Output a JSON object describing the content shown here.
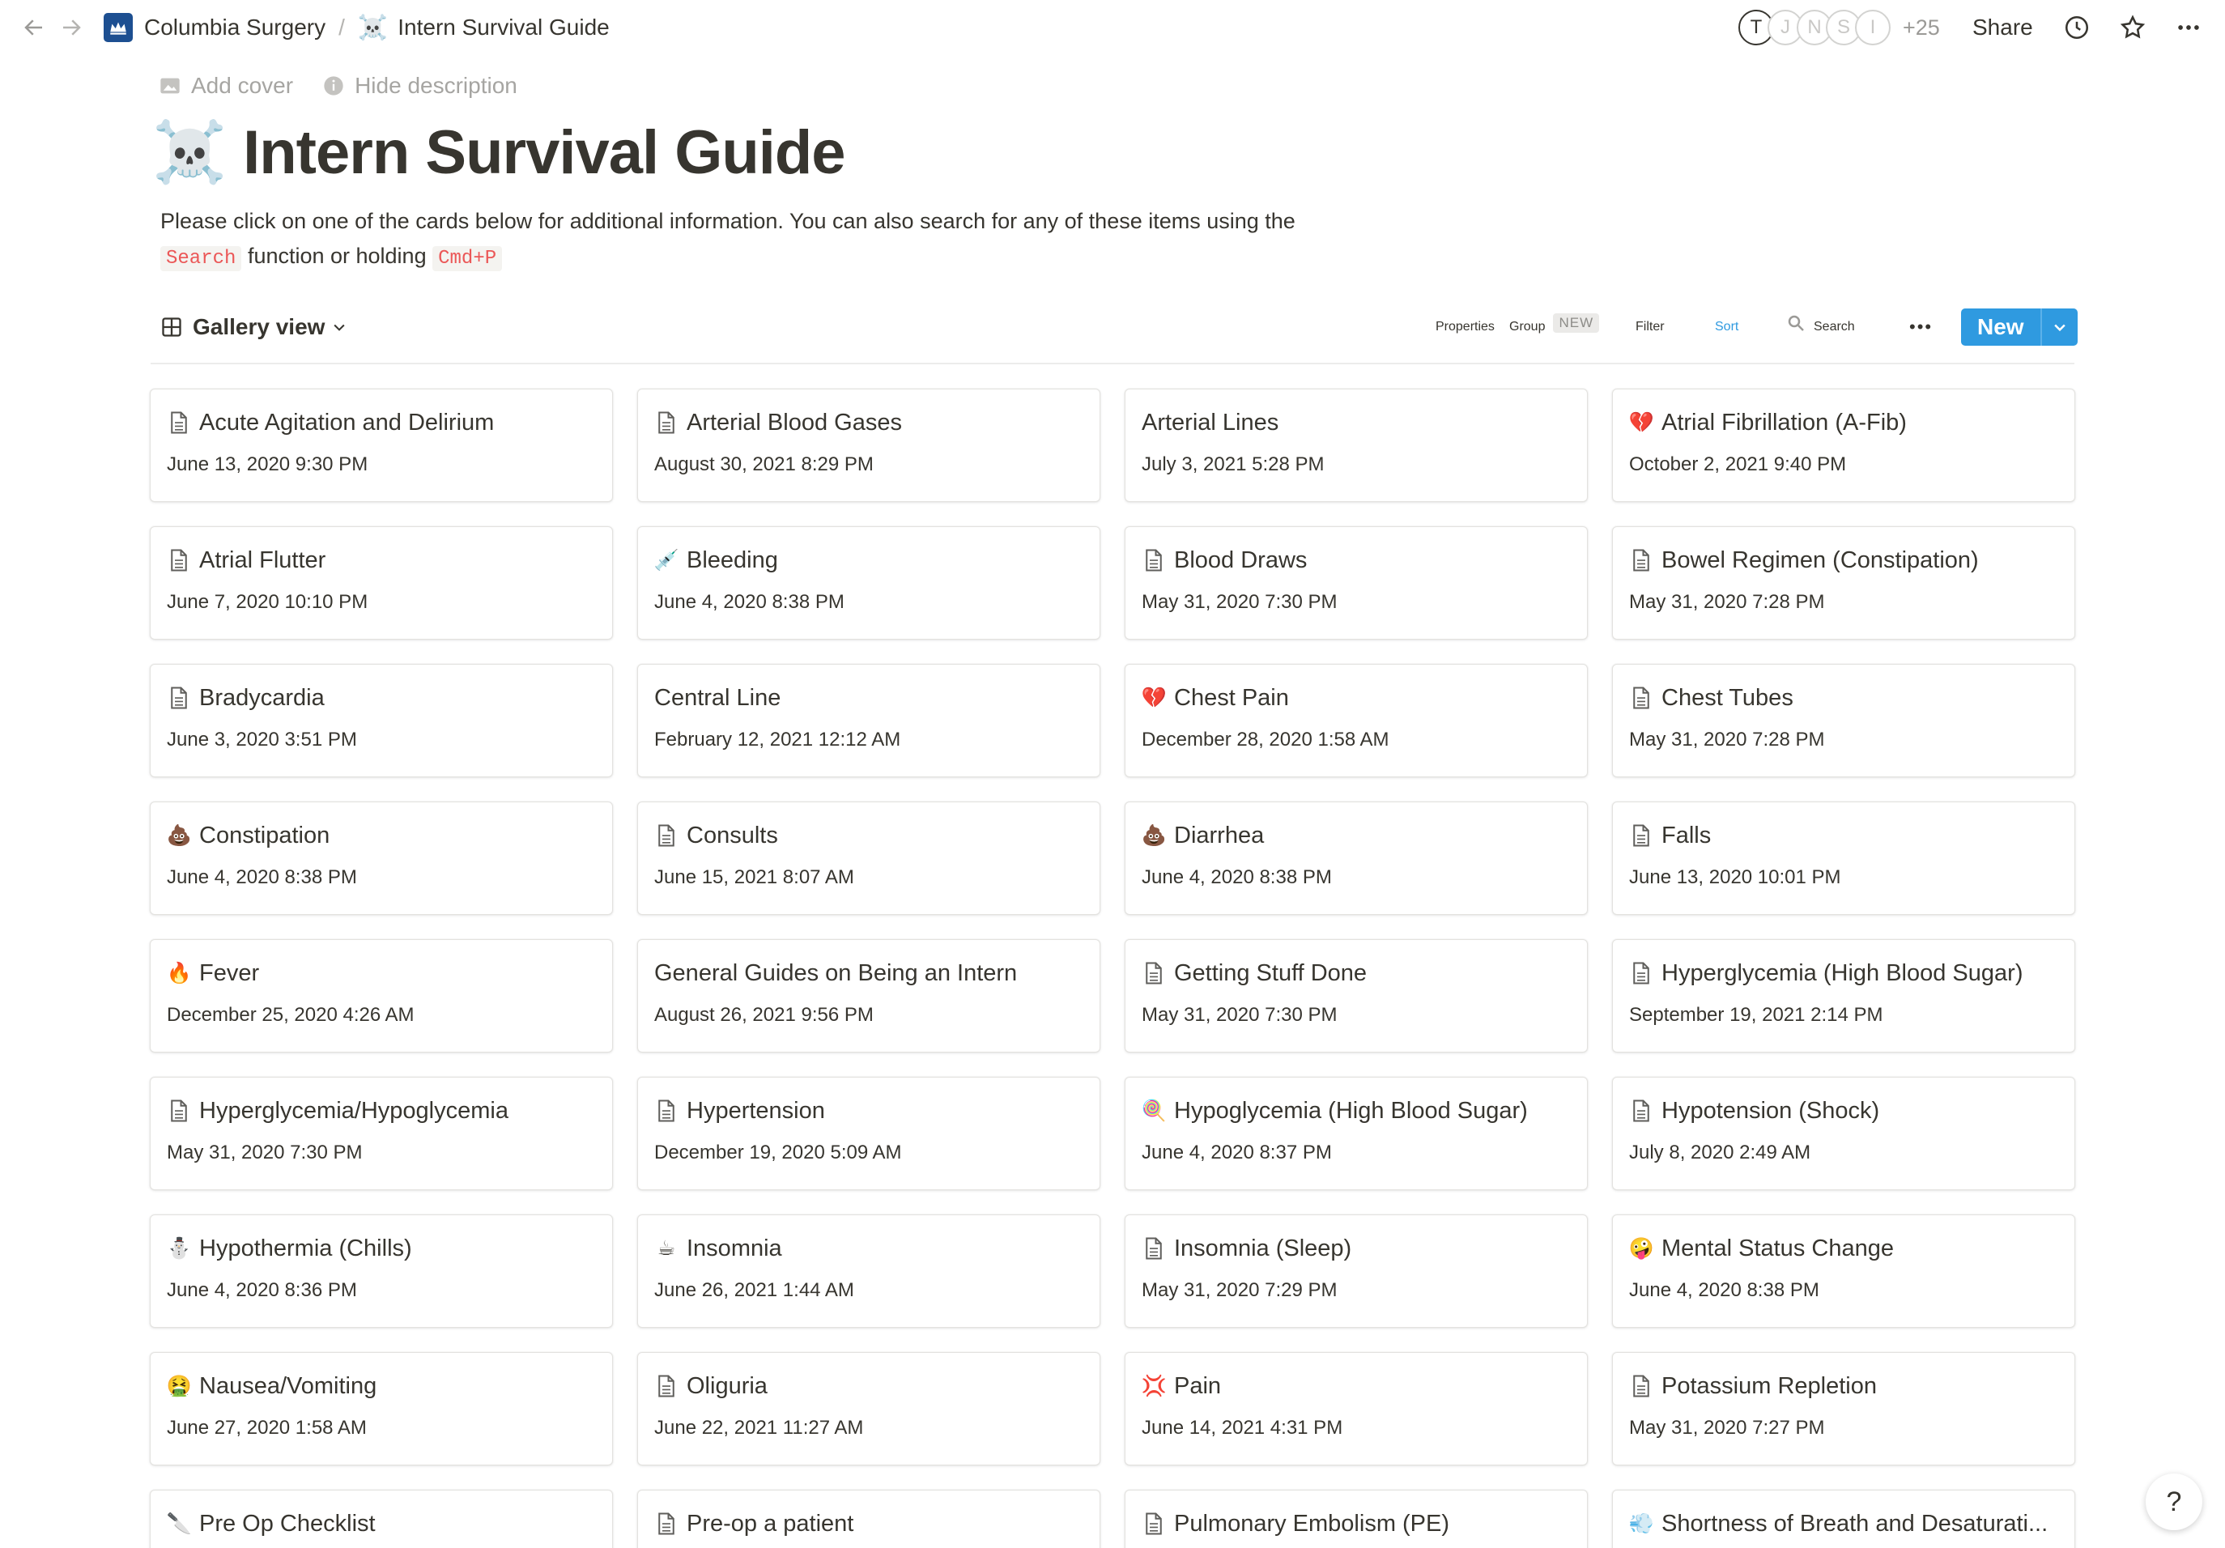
{
  "breadcrumb": {
    "workspace": "Columbia Surgery",
    "separator": "/",
    "page_emoji": "☠️",
    "page": "Intern Survival Guide"
  },
  "topbar": {
    "avatars": [
      "T",
      "J",
      "N",
      "S",
      "I"
    ],
    "more_users": "+25",
    "share": "Share"
  },
  "page_meta": {
    "add_cover": "Add cover",
    "hide_description": "Hide description"
  },
  "title": {
    "emoji": "☠️",
    "text": "Intern Survival Guide"
  },
  "description": {
    "line1": "Please click on one of the cards below for additional information. You can also search for any of these items using the",
    "code1": "Search",
    "middle": "function or holding",
    "code2": "Cmd+P"
  },
  "view": {
    "label": "Gallery view",
    "properties": "Properties",
    "group": "Group",
    "group_badge": "NEW",
    "filter": "Filter",
    "sort": "Sort",
    "search": "Search",
    "more": "•••",
    "new": "New"
  },
  "cards": [
    {
      "icon": "page",
      "title": "Acute Agitation and Delirium",
      "date": "June 13, 2020 9:30 PM"
    },
    {
      "icon": "page",
      "title": "Arterial Blood Gases",
      "date": "August 30, 2021 8:29 PM"
    },
    {
      "icon": "",
      "title": "Arterial Lines",
      "date": "July 3, 2021 5:28 PM"
    },
    {
      "icon": "💔",
      "title": "Atrial Fibrillation (A-Fib)",
      "date": "October 2, 2021 9:40 PM"
    },
    {
      "icon": "page",
      "title": "Atrial Flutter",
      "date": "June 7, 2020 10:10 PM"
    },
    {
      "icon": "💉",
      "title": "Bleeding",
      "date": "June 4, 2020 8:38 PM"
    },
    {
      "icon": "page",
      "title": "Blood Draws",
      "date": "May 31, 2020 7:30 PM"
    },
    {
      "icon": "page",
      "title": "Bowel Regimen (Constipation)",
      "date": "May 31, 2020 7:28 PM"
    },
    {
      "icon": "page",
      "title": "Bradycardia",
      "date": "June 3, 2020 3:51 PM"
    },
    {
      "icon": "",
      "title": "Central Line",
      "date": "February 12, 2021 12:12 AM"
    },
    {
      "icon": "💔",
      "title": "Chest Pain",
      "date": "December 28, 2020 1:58 AM"
    },
    {
      "icon": "page",
      "title": "Chest Tubes",
      "date": "May 31, 2020 7:28 PM"
    },
    {
      "icon": "💩",
      "title": "Constipation",
      "date": "June 4, 2020 8:38 PM"
    },
    {
      "icon": "page",
      "title": "Consults",
      "date": "June 15, 2021 8:07 AM"
    },
    {
      "icon": "💩",
      "title": "Diarrhea",
      "date": "June 4, 2020 8:38 PM"
    },
    {
      "icon": "page",
      "title": "Falls",
      "date": "June 13, 2020 10:01 PM"
    },
    {
      "icon": "🔥",
      "title": "Fever",
      "date": "December 25, 2020 4:26 AM"
    },
    {
      "icon": "",
      "title": "General Guides on Being an Intern",
      "date": "August 26, 2021 9:56 PM"
    },
    {
      "icon": "page",
      "title": "Getting Stuff Done",
      "date": "May 31, 2020 7:30 PM"
    },
    {
      "icon": "page",
      "title": "Hyperglycemia (High Blood Sugar)",
      "date": "September 19, 2021 2:14 PM"
    },
    {
      "icon": "page",
      "title": "Hyperglycemia/Hypoglycemia",
      "date": "May 31, 2020 7:30 PM"
    },
    {
      "icon": "page",
      "title": "Hypertension",
      "date": "December 19, 2020 5:09 AM"
    },
    {
      "icon": "🍭",
      "title": "Hypoglycemia (High Blood Sugar)",
      "date": "June 4, 2020 8:37 PM"
    },
    {
      "icon": "page",
      "title": "Hypotension (Shock)",
      "date": "July 8, 2020 2:49 AM"
    },
    {
      "icon": "⛄",
      "title": "Hypothermia (Chills)",
      "date": "June 4, 2020 8:36 PM"
    },
    {
      "icon": "☕",
      "title": "Insomnia",
      "date": "June 26, 2021 1:44 AM"
    },
    {
      "icon": "page",
      "title": "Insomnia (Sleep)",
      "date": "May 31, 2020 7:29 PM"
    },
    {
      "icon": "🤪",
      "title": "Mental Status Change",
      "date": "June 4, 2020 8:38 PM"
    },
    {
      "icon": "🤮",
      "title": "Nausea/Vomiting",
      "date": "June 27, 2020 1:58 AM"
    },
    {
      "icon": "page",
      "title": "Oliguria",
      "date": "June 22, 2021 11:27 AM"
    },
    {
      "icon": "💢",
      "title": "Pain",
      "date": "June 14, 2021 4:31 PM"
    },
    {
      "icon": "page",
      "title": "Potassium Repletion",
      "date": "May 31, 2020 7:27 PM"
    },
    {
      "icon": "🔪",
      "title": "Pre Op Checklist",
      "date": ""
    },
    {
      "icon": "page",
      "title": "Pre-op a patient",
      "date": ""
    },
    {
      "icon": "page",
      "title": "Pulmonary Embolism (PE)",
      "date": ""
    },
    {
      "icon": "💨",
      "title": "Shortness of Breath and Desaturati...",
      "date": ""
    }
  ],
  "help": "?",
  "colors": {
    "accent": "#2f9ae0",
    "text": "#37352f",
    "muted": "#9b9a97",
    "code": "#eb5757"
  }
}
